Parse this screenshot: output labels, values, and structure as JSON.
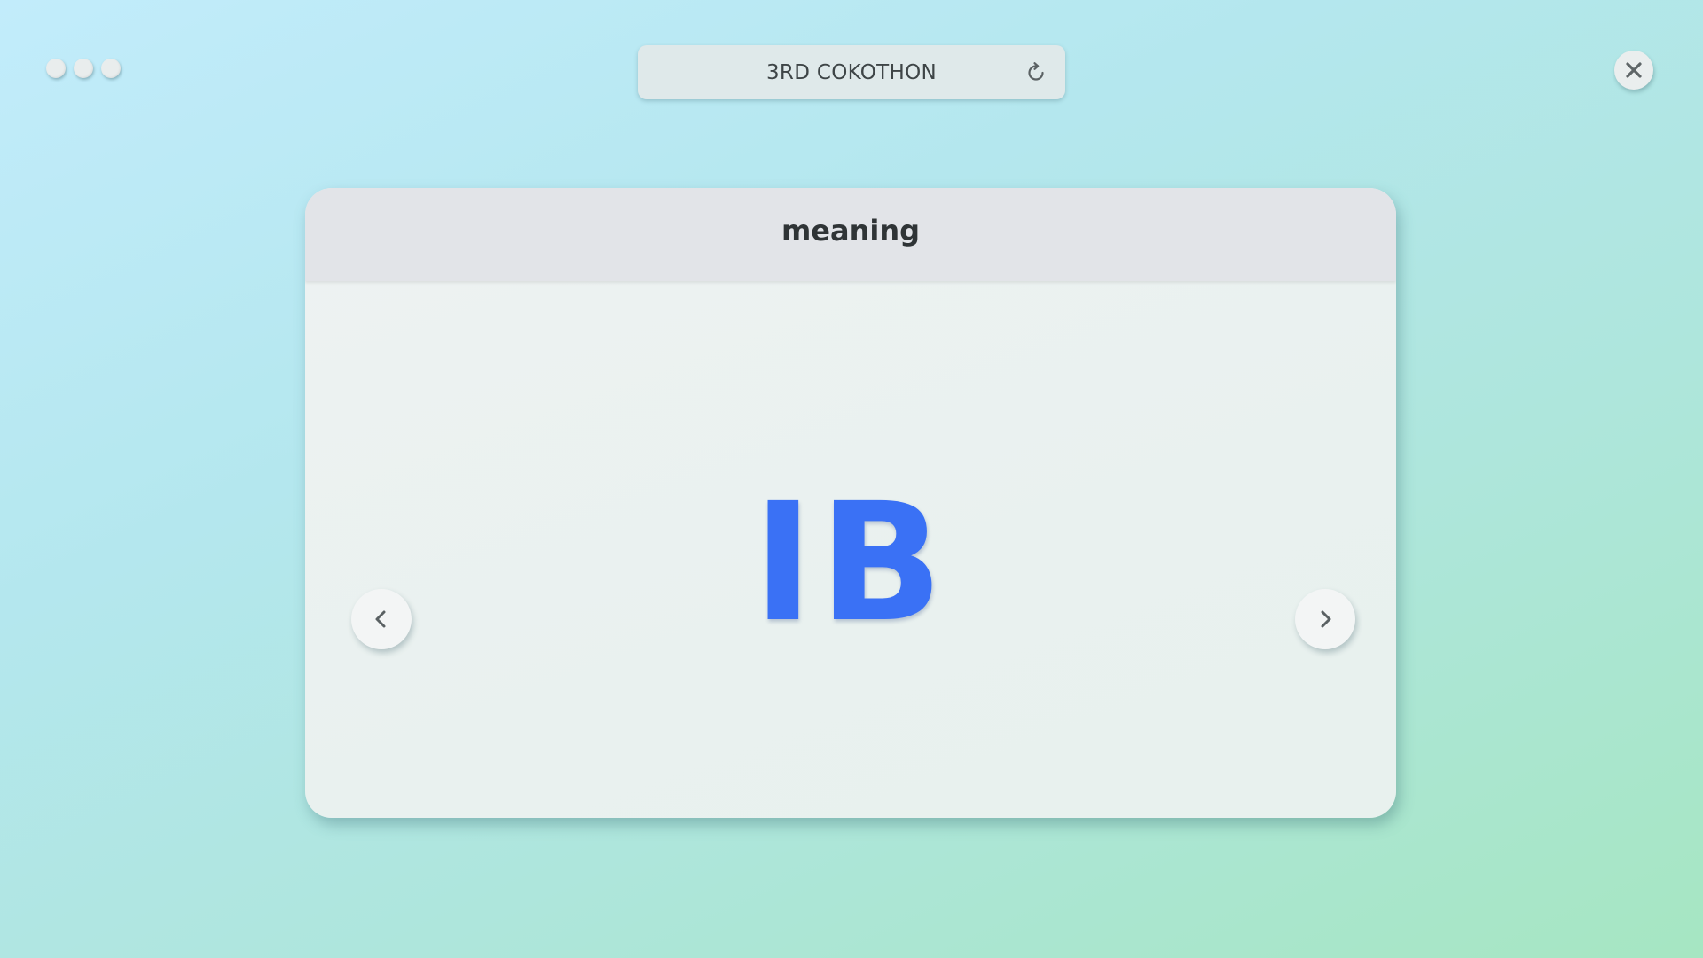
{
  "window": {
    "title": "3RD COKOTHON",
    "controls": {
      "dots": [
        "menu-dot",
        "menu-dot",
        "menu-dot"
      ],
      "refresh_icon": "refresh-icon",
      "close_icon": "close-icon"
    }
  },
  "card": {
    "header": "meaning",
    "word": "IB",
    "prev_icon": "chevron-left-icon",
    "next_icon": "chevron-right-icon"
  },
  "colors": {
    "word": "#3a71f5",
    "header_bg": "#e2e4e8",
    "card_bg": "#eef2f2",
    "title_bar_bg": "#dfe9ea",
    "icon": "#5a6163"
  }
}
